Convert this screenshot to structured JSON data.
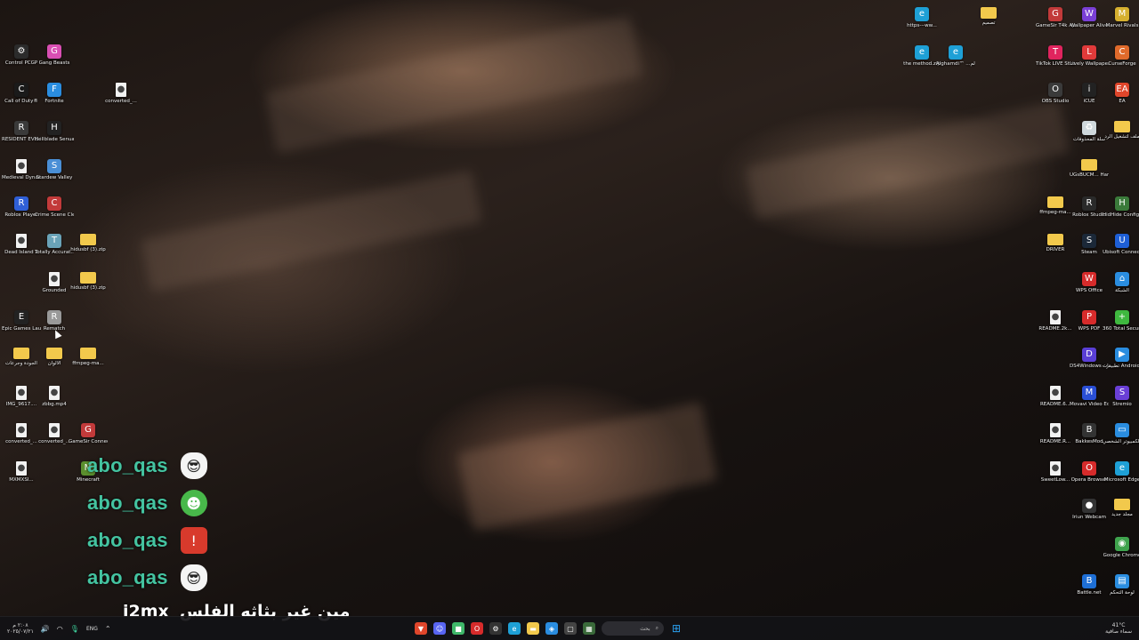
{
  "desktop_icons": [
    {
      "id": "control-pcgp",
      "label": "Control PCGP",
      "glyph": "⚙",
      "color": "#2b2b2b",
      "kind": "app"
    },
    {
      "id": "gang-beasts",
      "label": "Gang Beasts",
      "glyph": "G",
      "color": "#d94fb3",
      "kind": "app"
    },
    {
      "id": "call-of-duty",
      "label": "Call of Duty®",
      "glyph": "C",
      "color": "#1a1a1a",
      "kind": "app"
    },
    {
      "id": "fortnite",
      "label": "Fortnite",
      "glyph": "F",
      "color": "#2a8de0",
      "kind": "app"
    },
    {
      "id": "converted-1",
      "label": "converted_...",
      "glyph": "●",
      "color": "#fff",
      "kind": "file"
    },
    {
      "id": "resident-evil",
      "label": "RESIDENT EVIL 2",
      "glyph": "R",
      "color": "#3a3a3a",
      "kind": "app"
    },
    {
      "id": "hellblade",
      "label": "Hellblade Senua's...",
      "glyph": "H",
      "color": "#222",
      "kind": "app"
    },
    {
      "id": "medieval-dynasty",
      "label": "Medieval Dynasty",
      "glyph": "●",
      "color": "#fff",
      "kind": "file"
    },
    {
      "id": "stardew-valley",
      "label": "Stardew Valley",
      "glyph": "S",
      "color": "#4a8fd6",
      "kind": "app"
    },
    {
      "id": "roblox-player",
      "label": "Roblox Player",
      "glyph": "R",
      "color": "#2f5fd6",
      "kind": "app"
    },
    {
      "id": "crime-scene-cleaner",
      "label": "Crime Scene Cleaner",
      "glyph": "C",
      "color": "#c23a3a",
      "kind": "app"
    },
    {
      "id": "dead-island",
      "label": "Dead Island 2",
      "glyph": "●",
      "color": "#fff",
      "kind": "file"
    },
    {
      "id": "totally-accurate",
      "label": "Totally Accurat...",
      "glyph": "T",
      "color": "#6aa3b8",
      "kind": "app"
    },
    {
      "id": "hidusbf-1",
      "label": "hidusbf (3).zip",
      "glyph": "",
      "color": "#f2c94c",
      "kind": "folder"
    },
    {
      "id": "grounded",
      "label": "Grounded",
      "glyph": "●",
      "color": "#fff",
      "kind": "file"
    },
    {
      "id": "hidusbf-2",
      "label": "hidusbf (3).zip",
      "glyph": "",
      "color": "#f2c94c",
      "kind": "folder"
    },
    {
      "id": "epic-games",
      "label": "Epic Games Launcher",
      "glyph": "E",
      "color": "#222",
      "kind": "app"
    },
    {
      "id": "rematch",
      "label": "Rematch",
      "glyph": "R",
      "color": "#999",
      "kind": "app"
    },
    {
      "id": "folder-ar-1",
      "label": "الجودة وجرعات",
      "glyph": "",
      "color": "#f2c94c",
      "kind": "folder"
    },
    {
      "id": "folder-ar-2",
      "label": "الألوان",
      "glyph": "",
      "color": "#f2c94c",
      "kind": "folder"
    },
    {
      "id": "ffmpeg-1",
      "label": "ffmpeg-ma...",
      "glyph": "",
      "color": "#f2c94c",
      "kind": "folder"
    },
    {
      "id": "img-file",
      "label": "IMG_9617....",
      "glyph": "●",
      "color": "#fff",
      "kind": "file"
    },
    {
      "id": "zbbg",
      "label": "zbbg.mp4",
      "glyph": "●",
      "color": "#fff",
      "kind": "file"
    },
    {
      "id": "converted-2",
      "label": "converted_...",
      "glyph": "●",
      "color": "#fff",
      "kind": "file"
    },
    {
      "id": "converted-3",
      "label": "converted_...",
      "glyph": "●",
      "color": "#fff",
      "kind": "file"
    },
    {
      "id": "gamesir-connect",
      "label": "GameSir Connect",
      "glyph": "G",
      "color": "#c23a3a",
      "kind": "app"
    },
    {
      "id": "mxmxsi",
      "label": "MXMXSI...",
      "glyph": "●",
      "color": "#fff",
      "kind": "file"
    },
    {
      "id": "minecraft",
      "label": "Minecraft",
      "glyph": "M",
      "color": "#5b8f2e",
      "kind": "app"
    },
    {
      "id": "https-link",
      "label": "https---ww...",
      "glyph": "e",
      "color": "#1ea0d6",
      "kind": "app"
    },
    {
      "id": "folder-design",
      "label": "تصميم",
      "glyph": "",
      "color": "#f2c94c",
      "kind": "folder"
    },
    {
      "id": "the-method",
      "label": "the method.zip",
      "glyph": "e",
      "color": "#1ea0d6",
      "kind": "app"
    },
    {
      "id": "alghamdi",
      "label": "Alghamdi™ ...الله لم",
      "glyph": "e",
      "color": "#1ea0d6",
      "kind": "app"
    },
    {
      "id": "gamesir-t4k",
      "label": "GameSir T4k App",
      "glyph": "G",
      "color": "#c23a3a",
      "kind": "app"
    },
    {
      "id": "wallpaper-alive",
      "label": "Wallpaper Alive",
      "glyph": "W",
      "color": "#7a3fd6",
      "kind": "app"
    },
    {
      "id": "marvel-rivals",
      "label": "Marvel Rivals",
      "glyph": "M",
      "color": "#d6b02f",
      "kind": "app"
    },
    {
      "id": "tiktok-live",
      "label": "TikTok LIVE Studio",
      "glyph": "T",
      "color": "#e0245e",
      "kind": "app"
    },
    {
      "id": "lively-wallpaper",
      "label": "Lively Wallpaper",
      "glyph": "L",
      "color": "#e03a3a",
      "kind": "app"
    },
    {
      "id": "curseforge",
      "label": "CurseForge",
      "glyph": "C",
      "color": "#e06a2b",
      "kind": "app"
    },
    {
      "id": "obs-studio",
      "label": "OBS Studio",
      "glyph": "O",
      "color": "#3a3a3a",
      "kind": "app"
    },
    {
      "id": "icue",
      "label": "iCUE",
      "glyph": "i",
      "color": "#222",
      "kind": "app"
    },
    {
      "id": "ea",
      "label": "EA",
      "glyph": "EA",
      "color": "#e0462b",
      "kind": "app"
    },
    {
      "id": "recycle-bin",
      "label": "سلة المحذوفات",
      "glyph": "♻",
      "color": "#cfd8dc",
      "kind": "app"
    },
    {
      "id": "folder-rd",
      "label": "ملف لتشغيل الرد",
      "glyph": "",
      "color": "#f2c94c",
      "kind": "folder"
    },
    {
      "id": "ugbucm",
      "label": "UGsBUCM... Hana - GLS...",
      "glyph": "",
      "color": "#f2c94c",
      "kind": "folder"
    },
    {
      "id": "ffmpeg-2",
      "label": "ffmpeg-ma...",
      "glyph": "",
      "color": "#f2c94c",
      "kind": "folder"
    },
    {
      "id": "roblox-studio",
      "label": "Roblox Studio",
      "glyph": "R",
      "color": "#2a2a2a",
      "kind": "app"
    },
    {
      "id": "hidhide",
      "label": "HidHide Configurat...",
      "glyph": "H",
      "color": "#3a7a3a",
      "kind": "app"
    },
    {
      "id": "driver",
      "label": "DRIVER",
      "glyph": "",
      "color": "#f2c94c",
      "kind": "folder"
    },
    {
      "id": "steam",
      "label": "Steam",
      "glyph": "S",
      "color": "#1b2838",
      "kind": "app"
    },
    {
      "id": "ubisoft",
      "label": "Ubisoft Connect",
      "glyph": "U",
      "color": "#1e5fd6",
      "kind": "app"
    },
    {
      "id": "wps-office",
      "label": "WPS Office",
      "glyph": "W",
      "color": "#d62b2b",
      "kind": "app"
    },
    {
      "id": "network",
      "label": "الشبكة",
      "glyph": "⌂",
      "color": "#2a8de0",
      "kind": "app"
    },
    {
      "id": "readme-1",
      "label": "README.2k...",
      "glyph": "●",
      "color": "#fff",
      "kind": "file"
    },
    {
      "id": "wps-pdf",
      "label": "WPS PDF",
      "glyph": "P",
      "color": "#d62b2b",
      "kind": "app"
    },
    {
      "id": "360-security",
      "label": "360 Total Security",
      "glyph": "+",
      "color": "#3fb83f",
      "kind": "app"
    },
    {
      "id": "ds4windows",
      "label": "DS4Windows - اختصار",
      "glyph": "D",
      "color": "#5a3fd6",
      "kind": "app"
    },
    {
      "id": "android-apps",
      "label": "تطبيقات Android ع...",
      "glyph": "▶",
      "color": "#2a8de0",
      "kind": "app"
    },
    {
      "id": "readme-2",
      "label": "README.6...",
      "glyph": "●",
      "color": "#fff",
      "kind": "file"
    },
    {
      "id": "movavi",
      "label": "Movavi Video Edit...",
      "glyph": "M",
      "color": "#2a4fd6",
      "kind": "app"
    },
    {
      "id": "stremio",
      "label": "Stremio",
      "glyph": "S",
      "color": "#6a3fd6",
      "kind": "app"
    },
    {
      "id": "readme-3",
      "label": "README.R...",
      "glyph": "●",
      "color": "#fff",
      "kind": "file"
    },
    {
      "id": "bakkesmod",
      "label": "BakkesMod",
      "glyph": "B",
      "color": "#333",
      "kind": "app"
    },
    {
      "id": "this-pc",
      "label": "هذا الكمبيوتر الشخصي",
      "glyph": "▭",
      "color": "#2a8de0",
      "kind": "app"
    },
    {
      "id": "sweetlow",
      "label": "SweetLow...",
      "glyph": "●",
      "color": "#fff",
      "kind": "file"
    },
    {
      "id": "opera",
      "label": "Opera Browser",
      "glyph": "O",
      "color": "#d62b2b",
      "kind": "app"
    },
    {
      "id": "edge",
      "label": "Microsoft Edge",
      "glyph": "e",
      "color": "#1ea0d6",
      "kind": "app"
    },
    {
      "id": "iriun",
      "label": "Iriun Webcam",
      "glyph": "●",
      "color": "#333",
      "kind": "app"
    },
    {
      "id": "new-folder",
      "label": "مجلد جديد",
      "glyph": "",
      "color": "#f2c94c",
      "kind": "folder"
    },
    {
      "id": "chrome",
      "label": "Google Chrome",
      "glyph": "◉",
      "color": "#3fa34d",
      "kind": "app"
    },
    {
      "id": "battlenet",
      "label": "Battle.net",
      "glyph": "B",
      "color": "#1e6fd6",
      "kind": "app"
    },
    {
      "id": "control-panel",
      "label": "لوحة التحكم",
      "glyph": "▤",
      "color": "#2a8de0",
      "kind": "app"
    }
  ],
  "chat": {
    "lines": [
      {
        "name": "abo_qas",
        "emote": "😎"
      },
      {
        "name": "abo_qas",
        "emote": "☻"
      },
      {
        "name": "abo_qas",
        "emote": "!"
      },
      {
        "name": "abo_qas",
        "emote": "😎"
      }
    ],
    "footer_tag": "i2mx",
    "footer_text": "مين غير بثاثه الفلس"
  },
  "taskbar": {
    "time": "٢:٠٨ م",
    "date": "٢٠٢٥/٠٧/٢١",
    "language": "ENG",
    "search_label": "بحث",
    "weather_temp": "41°C",
    "weather_desc": "سماء صافية"
  }
}
